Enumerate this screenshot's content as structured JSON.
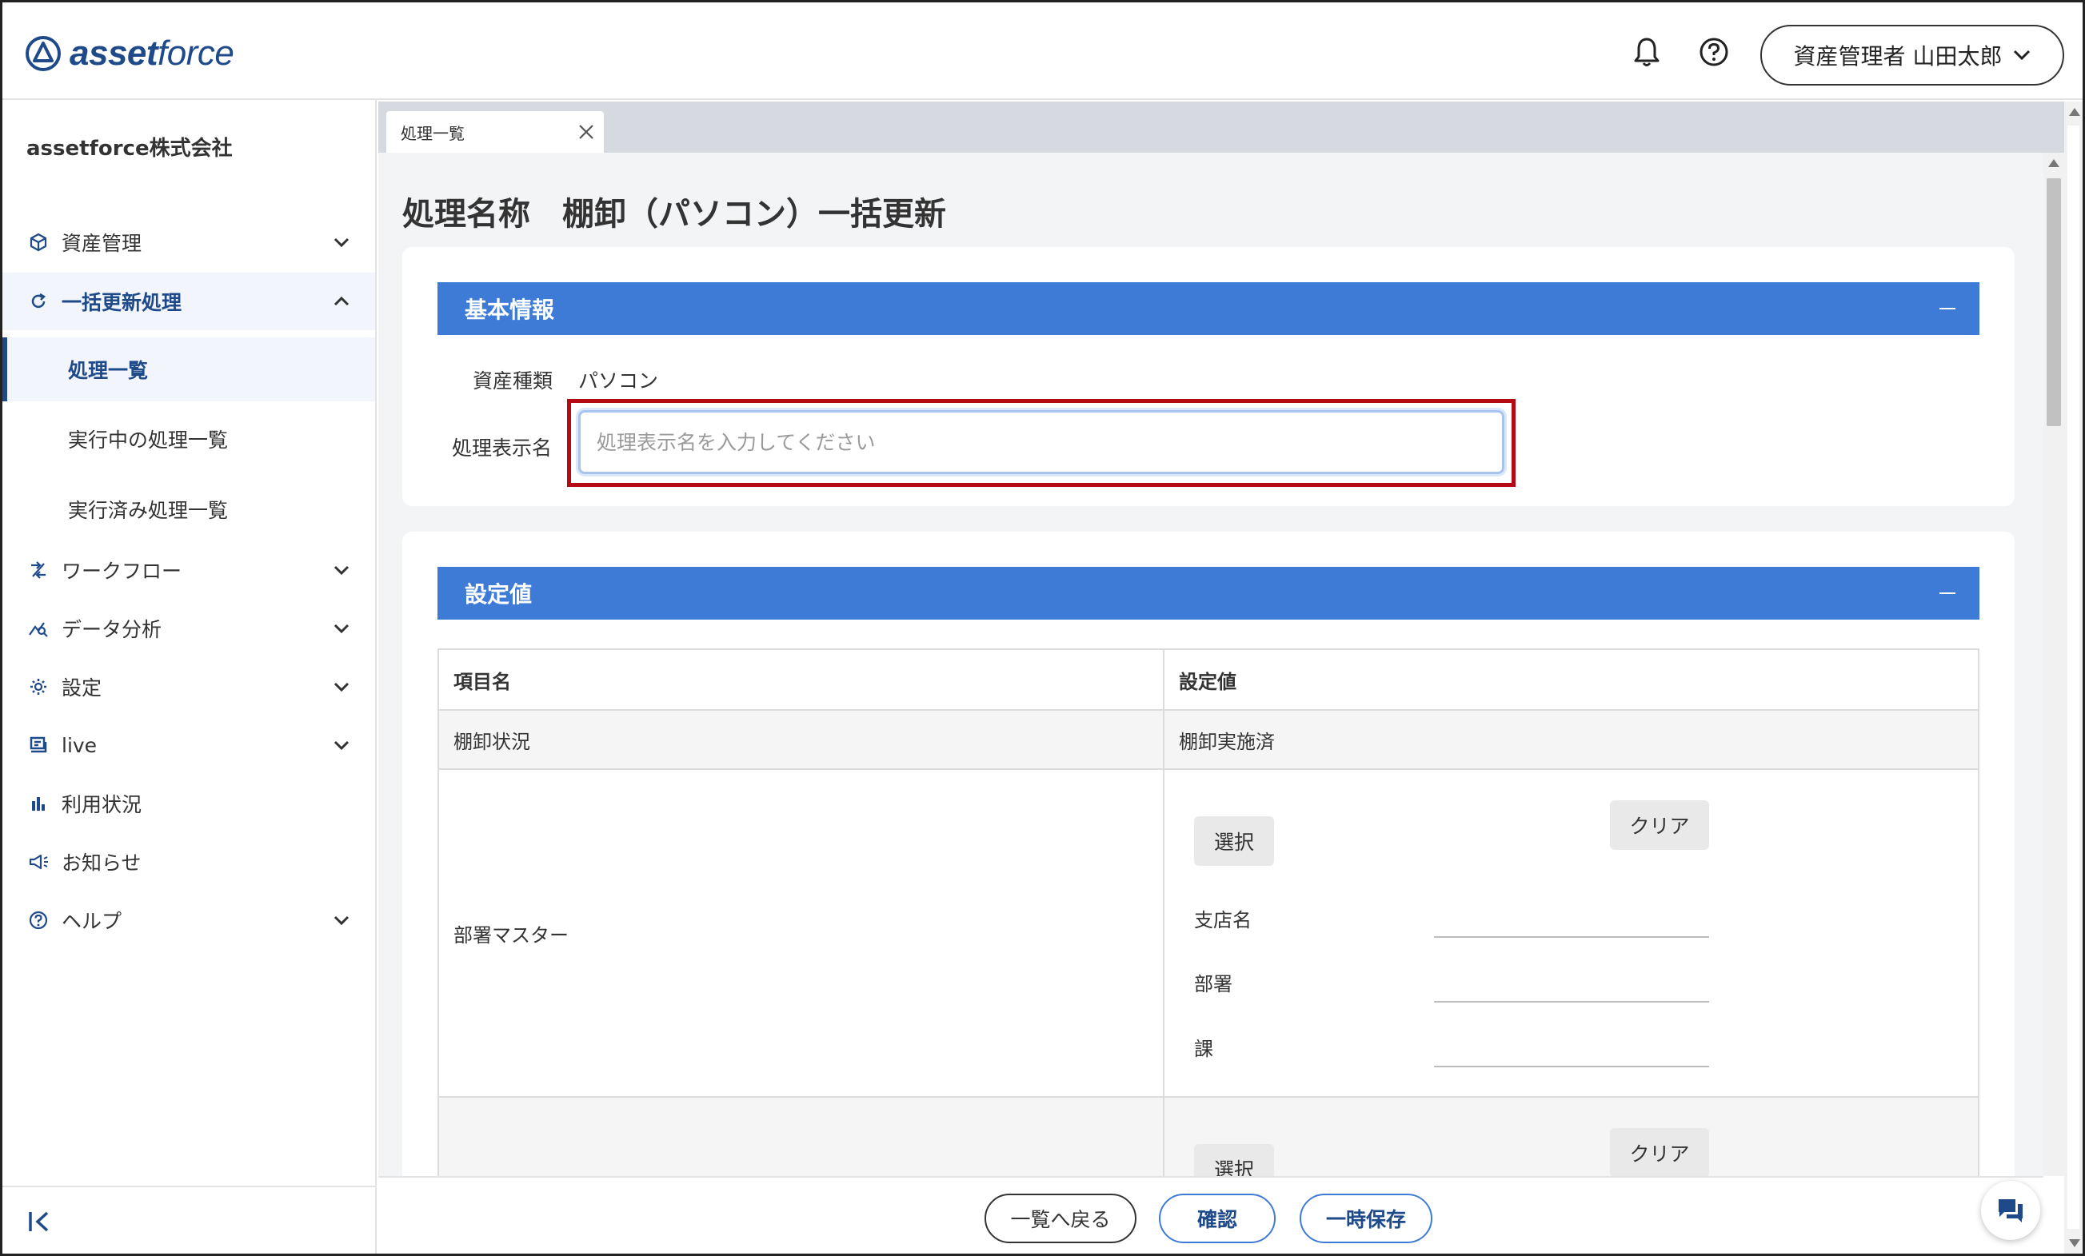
{
  "header": {
    "logo_bold": "asset",
    "logo_light": "force",
    "user_label": "資産管理者 山田太郎"
  },
  "sidebar": {
    "company": "assetforce株式会社",
    "items": [
      {
        "label": "資産管理",
        "icon": "cube-icon"
      },
      {
        "label": "一括更新処理",
        "icon": "refresh-icon"
      },
      {
        "label": "ワークフロー",
        "icon": "workflow-icon"
      },
      {
        "label": "データ分析",
        "icon": "analytics-icon"
      },
      {
        "label": "設定",
        "icon": "gear-icon"
      },
      {
        "label": "live",
        "icon": "live-icon"
      },
      {
        "label": "利用状況",
        "icon": "bar-chart-icon"
      },
      {
        "label": "お知らせ",
        "icon": "megaphone-icon"
      },
      {
        "label": "ヘルプ",
        "icon": "help-icon"
      }
    ],
    "sub_items": [
      {
        "label": "処理一覧"
      },
      {
        "label": "実行中の処理一覧"
      },
      {
        "label": "実行済み処理一覧"
      }
    ]
  },
  "tab": {
    "label": "処理一覧"
  },
  "main": {
    "title": "処理名称　棚卸（パソコン）一括更新",
    "basic": {
      "heading": "基本情報",
      "asset_type_label": "資産種類",
      "asset_type_value": "パソコン",
      "display_name_label": "処理表示名",
      "display_name_placeholder": "処理表示名を入力してください",
      "display_name_value": ""
    },
    "settings": {
      "heading": "設定値",
      "col_item": "項目名",
      "col_value": "設定値",
      "rows": [
        {
          "item": "棚卸状況",
          "value": "棚卸実施済"
        },
        {
          "item": "部署マスター",
          "select_label": "選択",
          "clear_label": "クリア",
          "fields": [
            "支店名",
            "部署",
            "課"
          ]
        },
        {
          "item": "",
          "select_label": "選択",
          "clear_label": "クリア"
        }
      ]
    }
  },
  "footer": {
    "back_label": "一覧へ戻る",
    "confirm_label": "確認",
    "save_label": "一時保存"
  },
  "colors": {
    "primary": "#3e7bd6",
    "brand": "#1f4a8a",
    "highlight": "#b40a14"
  }
}
